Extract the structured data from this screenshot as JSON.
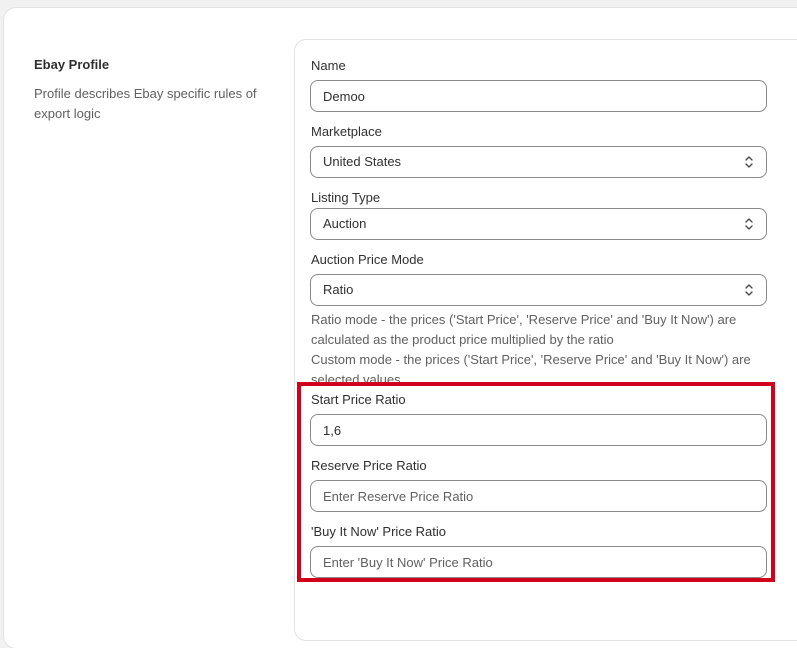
{
  "profile": {
    "title": "Ebay Profile",
    "description": "Profile describes Ebay specific rules of export logic"
  },
  "fields": {
    "name": {
      "label": "Name",
      "value": "Demoo"
    },
    "marketplace": {
      "label": "Marketplace",
      "value": "United States"
    },
    "listing_type": {
      "label": "Listing Type",
      "value": "Auction"
    },
    "auction_price_mode": {
      "label": "Auction Price Mode",
      "value": "Ratio",
      "help_ratio": "Ratio mode - the prices ('Start Price', 'Reserve Price' and 'Buy It Now') are calculated as the product price multiplied by the ratio",
      "help_custom": "Custom mode - the prices ('Start Price', 'Reserve Price' and 'Buy It Now') are selected values"
    },
    "start_price_ratio": {
      "label": "Start Price Ratio",
      "value": "1,6"
    },
    "reserve_price_ratio": {
      "label": "Reserve Price Ratio",
      "placeholder": "Enter Reserve Price Ratio"
    },
    "buy_it_now_price_ratio": {
      "label": "'Buy It Now' Price Ratio",
      "placeholder": "Enter 'Buy It Now' Price Ratio"
    }
  },
  "colors": {
    "highlight": "#d0021b",
    "border": "#8a8a8a"
  }
}
